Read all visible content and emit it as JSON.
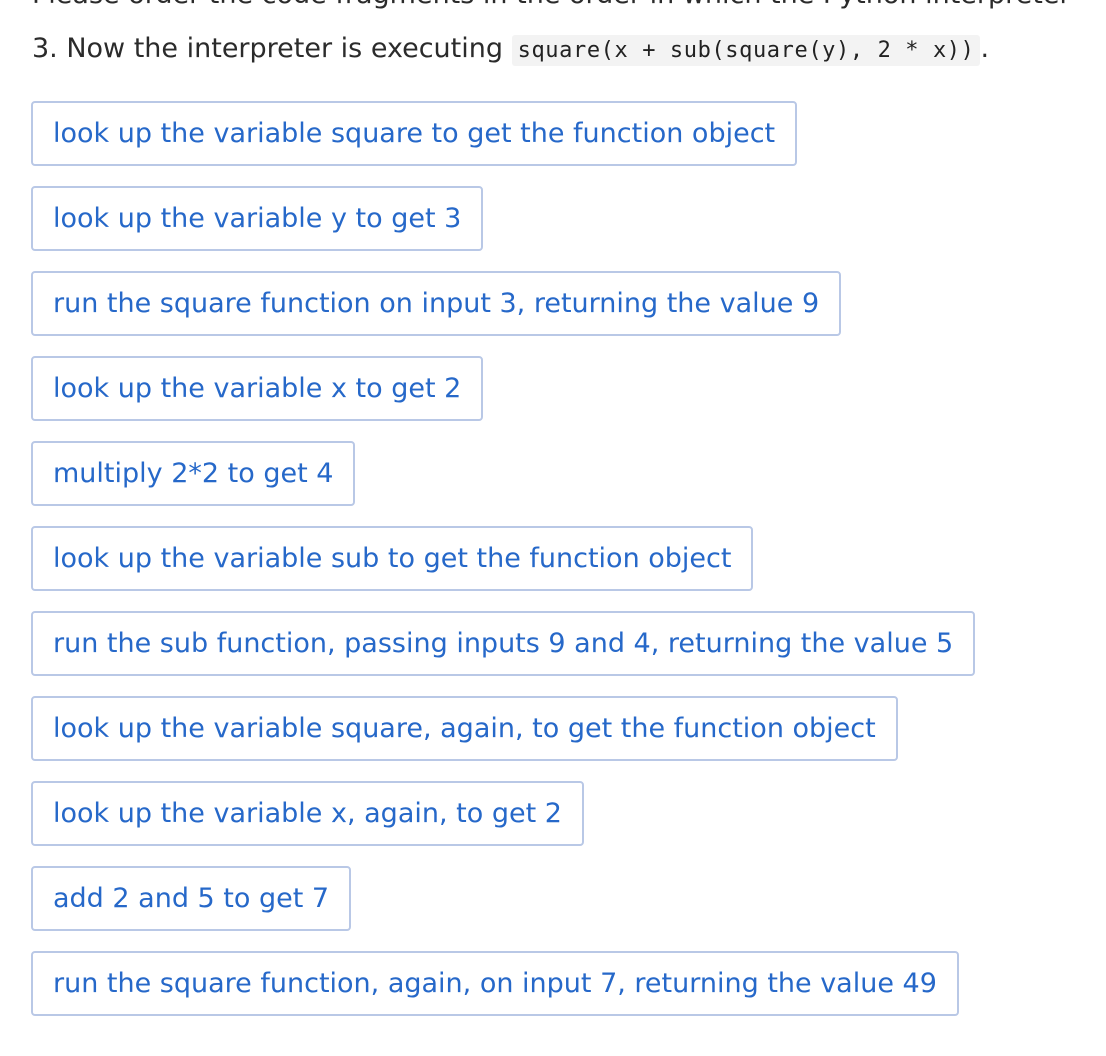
{
  "intro": {
    "line1": "Please order the code fragments in the order in which the Python interpreter",
    "line2_prefix": "3. Now the interpreter is executing ",
    "line2_code": "square(x + sub(square(y), 2 * x))",
    "line2_suffix": "."
  },
  "fragments": [
    "look up the variable square to get the function object",
    "look up the variable y to get 3",
    "run the square function on input 3, returning the value 9",
    "look up the variable x to get 2",
    "multiply 2*2 to get 4",
    "look up the variable sub to get the function object",
    "run the sub function, passing inputs 9 and 4, returning the value 5",
    "look up the variable square, again, to get the function object",
    "look up the variable x, again, to get 2",
    "add 2 and 5 to get 7",
    "run the square function, again, on input 7, returning the value 49"
  ]
}
